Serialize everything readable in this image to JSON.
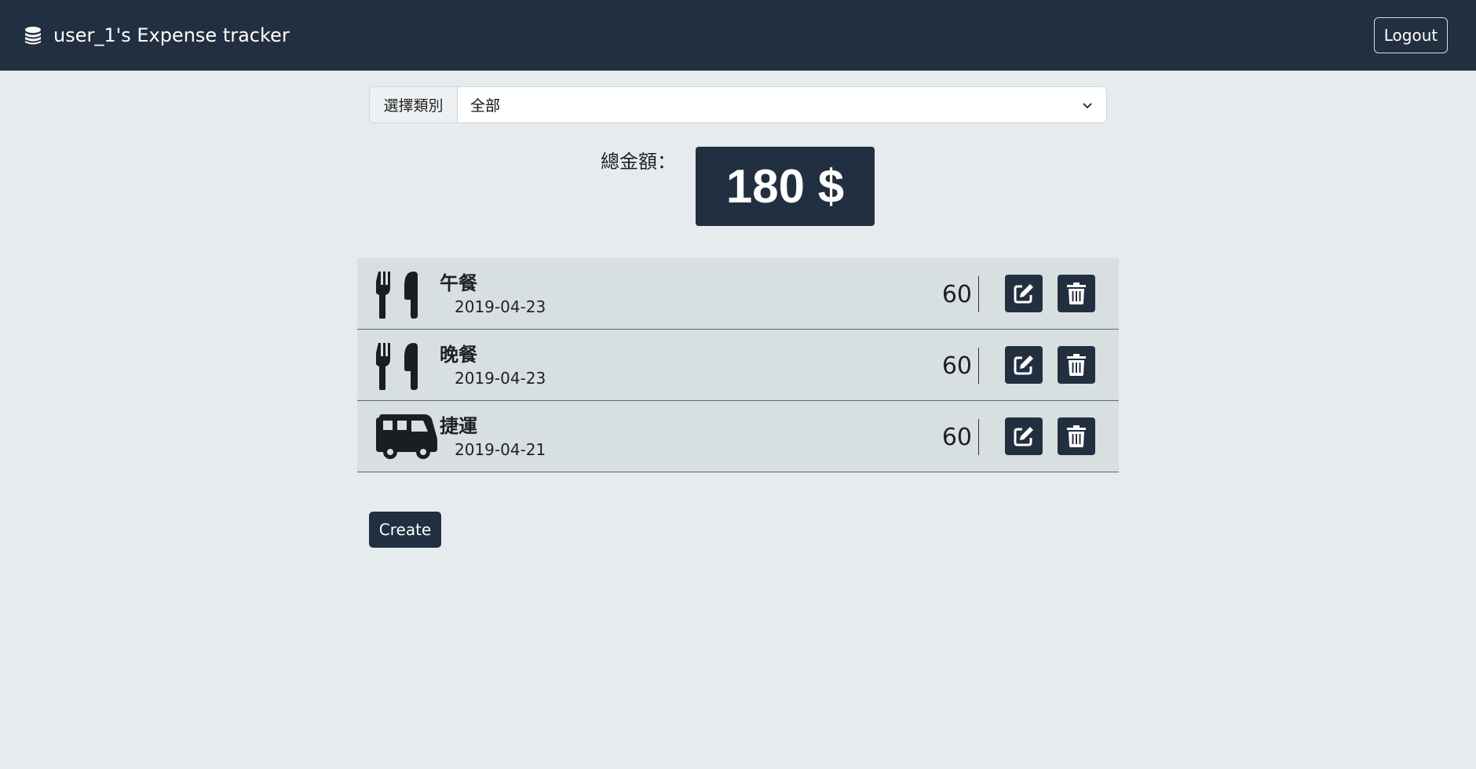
{
  "navbar": {
    "title": "user_1's Expense tracker",
    "brand_icon": "coins-icon",
    "logout_label": "Logout"
  },
  "filter": {
    "label": "選擇類別",
    "selected": "全部"
  },
  "total": {
    "label": "總金額：",
    "value": "180 $"
  },
  "records": [
    {
      "name": "午餐",
      "date": "2019-04-23",
      "amount": "60",
      "icon": "utensils-icon"
    },
    {
      "name": "晚餐",
      "date": "2019-04-23",
      "amount": "60",
      "icon": "utensils-icon"
    },
    {
      "name": "捷運",
      "date": "2019-04-21",
      "amount": "60",
      "icon": "bus-icon"
    }
  ],
  "create_label": "Create",
  "colors": {
    "navbar": "#222f40",
    "background": "#e6ebee",
    "row": "#d8dfe0",
    "button": "#222f40"
  }
}
